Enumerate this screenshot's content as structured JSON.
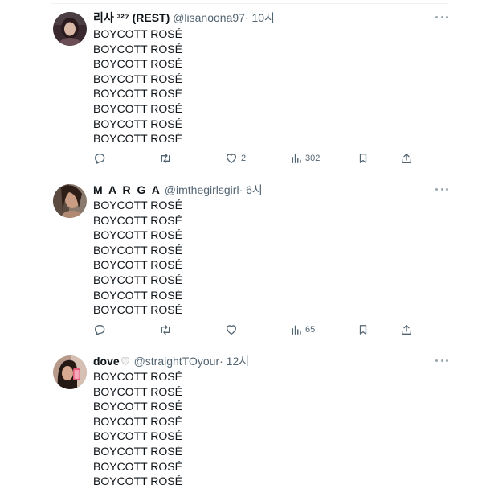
{
  "tweets": [
    {
      "name": "리사 ³²⁷ (REST)",
      "handle": "@lisanoona97",
      "time": "· 10시",
      "lines": [
        "BOYCOTT ROSÉ",
        "BOYCOTT ROSÉ",
        "BOYCOTT ROSÉ",
        "BOYCOTT ROSÉ",
        "BOYCOTT ROSÉ",
        "BOYCOTT ROSÉ",
        "BOYCOTT ROSÉ",
        "BOYCOTT ROSÉ"
      ],
      "likes": "2",
      "views": "302"
    },
    {
      "name": "M A R G A",
      "handle": "@imthegirlsgirl",
      "time": "· 6시",
      "lines": [
        "BOYCOTT ROSÉ",
        "BOYCOTT ROSÉ",
        "BOYCOTT ROSÉ",
        "BOYCOTT ROSÉ",
        "BOYCOTT ROSÉ",
        "BOYCOTT ROSÉ",
        "BOYCOTT ROSÉ",
        "BOYCOTT ROSÉ"
      ],
      "likes": "",
      "views": "65"
    },
    {
      "name": "dove",
      "handle": "@straightTOyour",
      "time": "· 12시",
      "lines": [
        "BOYCOTT ROSÉ",
        "BOYCOTT ROSÉ",
        "BOYCOTT ROSÉ",
        "BOYCOTT ROSÉ",
        "BOYCOTT ROSÉ",
        "BOYCOTT ROSÉ",
        "BOYCOTT ROSÉ",
        "BOYCOTT ROSÉ"
      ]
    }
  ],
  "icons": {
    "reply": "reply-icon",
    "retweet": "retweet-icon",
    "like": "heart-icon",
    "views": "views-icon",
    "bookmark": "bookmark-icon",
    "share": "share-icon",
    "more": "more-icon",
    "badge": "white-heart-icon"
  },
  "colors": {
    "text": "#0f1419",
    "secondary": "#536471",
    "divider": "#eff3f4"
  }
}
